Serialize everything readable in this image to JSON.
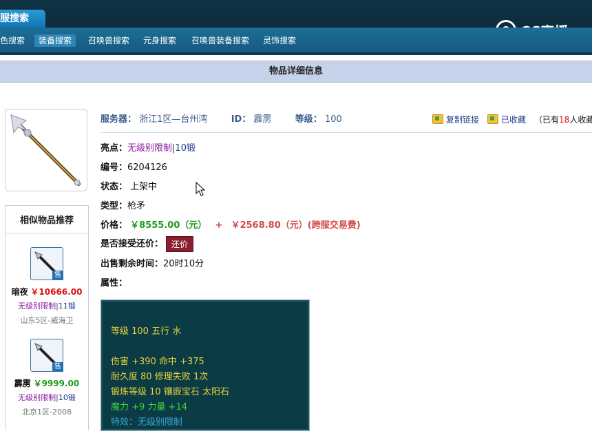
{
  "header": {
    "main_tab": "全服搜索",
    "logo_text": "CC直播",
    "nav": [
      {
        "label": "角色搜索"
      },
      {
        "label": "装备搜索",
        "active": true
      },
      {
        "label": "召唤兽搜索"
      },
      {
        "label": "元身搜索"
      },
      {
        "label": "召唤兽装备搜索"
      },
      {
        "label": "灵饰搜索"
      }
    ]
  },
  "page_title": "物品详细信息",
  "item": {
    "server_label": "服务器：",
    "server_value": "浙江1区—台州湾",
    "id_label": "ID：",
    "id_value": "霹雳",
    "level_label": "等级：",
    "level_value": "100",
    "copy_link": "复制链接",
    "favorited": "已收藏",
    "collect_prefix": "（已有",
    "collect_count": "18",
    "collect_suffix": "人收藏）",
    "highlight_label": "亮点：",
    "highlight_value": "无级别限制",
    "highlight_sep": "|",
    "highlight_value2": "10锻",
    "number_label": "编号：",
    "number_value": "6204126",
    "status_label": "状态：",
    "status_value": "上架中",
    "type_label": "类型：",
    "type_value": "枪矛",
    "price_label": "价格：",
    "price_value": "￥8555.00（元）",
    "price_plus": "+",
    "price_fee": "￥2568.80（元）(跨服交易费)",
    "counter_label": "是否接受还价：",
    "counter_button": "还价",
    "remaining_label": "出售剩余时间：",
    "remaining_value": "20时10分",
    "attrs_label": "属性：",
    "attrs": [
      {
        "text": "等级 100 五行 水",
        "color": "#e6d23a"
      },
      {
        "text": "伤害 +390 命中 +375",
        "color": "#e6d23a"
      },
      {
        "text": "耐久度 80 修理失败 1次",
        "color": "#e6d23a"
      },
      {
        "text": "锻炼等级 10 镶嵌宝石 太阳石",
        "color": "#e6d23a"
      },
      {
        "text": "魔力 +9 力量 +14",
        "color": "#3fd13f"
      },
      {
        "text": "特效：无级别限制",
        "color": "#3aa3d6"
      }
    ]
  },
  "similar": {
    "title": "相似物品推荐",
    "items": [
      {
        "tag": "售",
        "name": "暗夜",
        "price": "￥10666.00",
        "price_color": "#d11",
        "highlight": "无级别限制",
        "sep": "|",
        "forge": "11锻",
        "server": "山东5区-威海卫"
      },
      {
        "tag": "售",
        "name": "霹雳",
        "price": "￥9999.00",
        "price_color": "#1a9a1a",
        "highlight": "无级别限制",
        "sep": "|",
        "forge": "10锻",
        "server": "北京1区-2008"
      }
    ]
  },
  "colors": {
    "header_dark": "#0d2a3a",
    "nav_blue": "#1d6e97",
    "title_bar": "#c5d3ea",
    "attr_bg": "#0b3b44"
  }
}
